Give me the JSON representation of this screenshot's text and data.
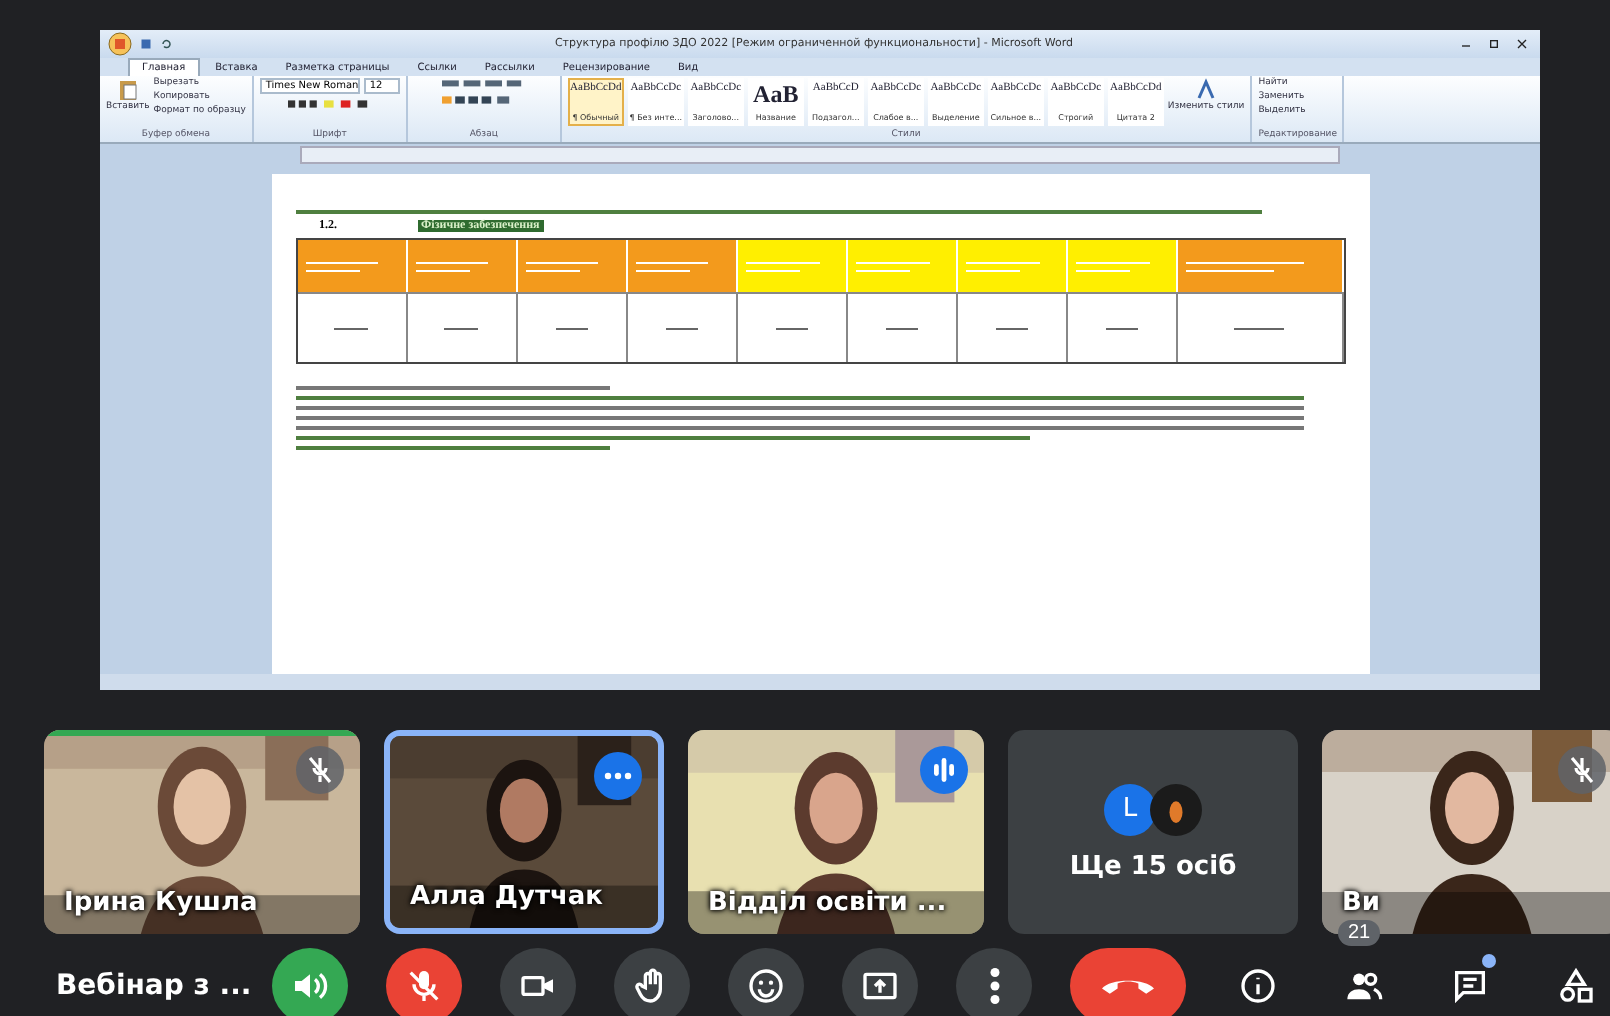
{
  "shared_screen": {
    "window_title": "Структура профілю ЗДО 2022 [Режим ограниченной функциональности] - Microsoft Word",
    "ribbon_tabs": [
      {
        "label": "Главная",
        "selected": true
      },
      {
        "label": "Вставка",
        "selected": false
      },
      {
        "label": "Разметка страницы",
        "selected": false
      },
      {
        "label": "Ссылки",
        "selected": false
      },
      {
        "label": "Рассылки",
        "selected": false
      },
      {
        "label": "Рецензирование",
        "selected": false
      },
      {
        "label": "Вид",
        "selected": false
      }
    ],
    "clipboard": {
      "paste": "Вставить",
      "items": [
        "Вырезать",
        "Копировать",
        "Формат по образцу"
      ]
    },
    "font_name": "Times New Roman",
    "font_size": "12",
    "styles": [
      {
        "preview": "AaBbCcDd",
        "name": "¶ Обычный",
        "selected": true
      },
      {
        "preview": "AaBbCcDc",
        "name": "¶ Без инте...",
        "selected": false
      },
      {
        "preview": "AaBbCcDc",
        "name": "Заголово...",
        "selected": false
      },
      {
        "preview": "AaB",
        "name": "Название",
        "selected": false
      },
      {
        "preview": "AaBbCcD",
        "name": "Подзагол...",
        "selected": false
      },
      {
        "preview": "AaBbCcDc",
        "name": "Слабое в...",
        "selected": false
      },
      {
        "preview": "AaBbCcDc",
        "name": "Выделение",
        "selected": false
      },
      {
        "preview": "AaBbCcDc",
        "name": "Сильное в...",
        "selected": false
      },
      {
        "preview": "AaBbCcDc",
        "name": "Строгий",
        "selected": false
      },
      {
        "preview": "AaBbCcDd",
        "name": "Цитата 2",
        "selected": false
      }
    ],
    "change_styles": "Изменить стили",
    "editing": [
      "Найти",
      "Заменить",
      "Выделить"
    ],
    "group_labels": [
      "Буфер обмена",
      "Шрифт",
      "Абзац",
      "Стили",
      "Редактирование"
    ],
    "heading_number": "1.2.",
    "heading": "Фізичне забезпечення"
  },
  "participants": [
    {
      "name": "Ірина Кушла",
      "muted": true,
      "speaking": false,
      "selected": false,
      "active_speaker": true
    },
    {
      "name": "Алла Дутчак",
      "muted": false,
      "speaking": false,
      "selected": true,
      "active_speaker": false
    },
    {
      "name": "Відділ освіти ...",
      "muted": false,
      "speaking": true,
      "selected": false,
      "active_speaker": false
    },
    {
      "name": "Ви",
      "muted": true,
      "speaking": false,
      "selected": false,
      "active_speaker": false
    }
  ],
  "more_participants": {
    "avatar_initial": "L",
    "label": "Ще 15 осіб"
  },
  "meeting_title": "Вебінар з ...",
  "controls": [
    {
      "kind": "speaker"
    },
    {
      "kind": "mic_off"
    },
    {
      "kind": "camera"
    },
    {
      "kind": "hand"
    },
    {
      "kind": "emoji"
    },
    {
      "kind": "present"
    },
    {
      "kind": "more"
    },
    {
      "kind": "end_call"
    },
    {
      "kind": "info"
    },
    {
      "kind": "people",
      "badge": "21"
    },
    {
      "kind": "chat",
      "unread": true
    },
    {
      "kind": "activities"
    }
  ]
}
